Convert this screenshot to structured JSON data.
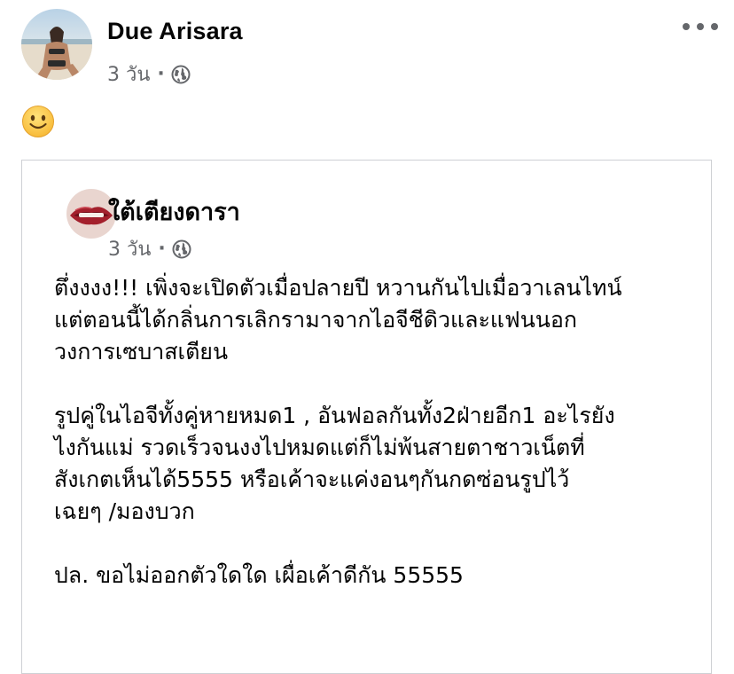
{
  "post": {
    "author": "Due Arisara",
    "time": "3 วัน",
    "separator": "·",
    "privacy_icon": "globe-icon",
    "more_icon": "more-options-icon",
    "body_emoji": "slightly-smiling-face-emoji"
  },
  "shared": {
    "author": "ใต้เตียงดารา",
    "time": "3 วัน",
    "separator": "·",
    "privacy_icon": "globe-icon",
    "paragraphs": [
      {
        "lines": [
          "ตึ่งงงง!!! เพิ่งจะเปิดตัวเมื่อปลายปี หวานกันไปเมื่อวาเลนไทน์",
          "แต่ตอนนี้ได้กลิ่นการเลิกรามาจากไอจีชีดิวและแฟนนอก",
          "วงการเซบาสเตียน"
        ]
      },
      {
        "lines": [
          "รูปคู่ในไอจีทั้งคู่หายหมด1 , อันฟอลกันทั้ง2ฝ่ายอีก1  อะไรยัง",
          "ไงกันแม่ รวดเร็วจนงงไปหมดแต่ก็ไม่พ้นสายตาชาวเน็ตที่",
          "สังเกตเห็นได้5555 หรือเค้าจะแค่งอนๆกันกดซ่อนรูปไว้",
          "เฉยๆ /มองบวก"
        ]
      },
      {
        "lines": [
          "ปล. ขอไม่ออกตัวใดใด เผื่อเค้าดีกัน 55555"
        ]
      }
    ]
  },
  "colors": {
    "text": "#050505",
    "secondary": "#65676b",
    "border": "#ced0d4"
  }
}
